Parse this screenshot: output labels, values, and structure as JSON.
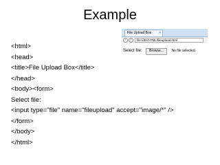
{
  "slide": {
    "title": "Example"
  },
  "code": {
    "lines": [
      "<html>",
      "<head>",
      "<title>File Upload Box</title>",
      "</head>",
      "<body><form>",
      "Select file:",
      "<input type=\"file\" name=\"fileupload\" accept=\"image/*\" />",
      "</form>",
      "</body>",
      "</html>"
    ]
  },
  "browser": {
    "tab_title": "File Upload Box",
    "tab_close": "×",
    "back_glyph": "‹",
    "forward_glyph": "›",
    "address": "file:///D:/HTML/fileupload.html",
    "page": {
      "label": "Select file:",
      "browse_label": "Browse...",
      "status": "No file selected."
    }
  }
}
